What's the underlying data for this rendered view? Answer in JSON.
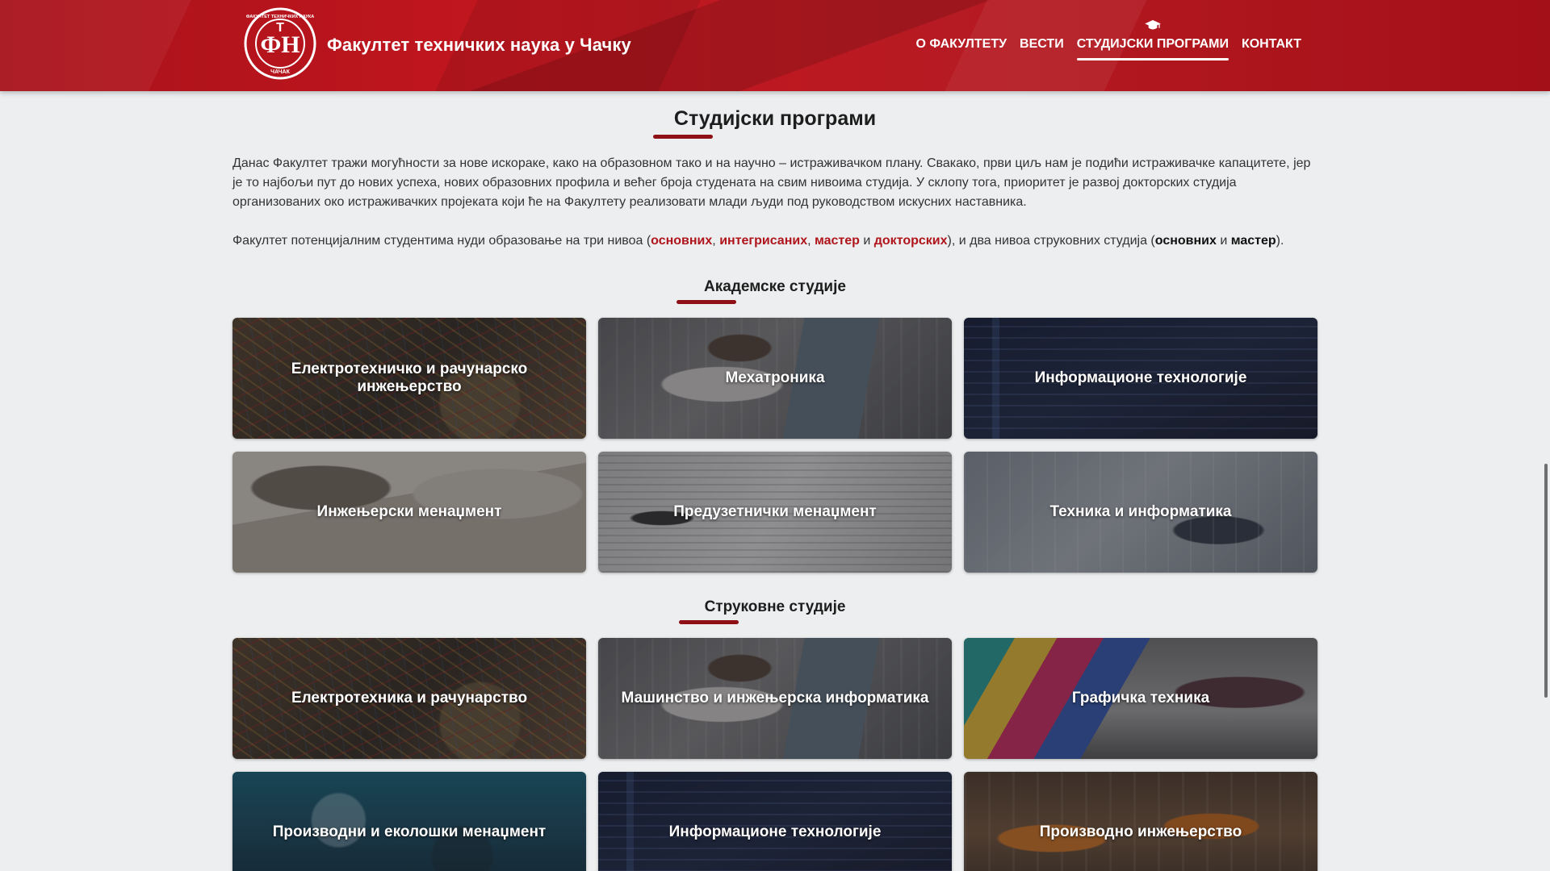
{
  "header": {
    "site_title": "Факултет техничких наука у Чачку",
    "logo_text": "ФТН",
    "logo_ring_top": "ФАКУЛТЕТ ТЕХНИЧКИХ НАУКА",
    "logo_ring_bottom": "ЧАЧАК",
    "nav": [
      {
        "label": "О ФАКУЛТЕТУ",
        "active": false
      },
      {
        "label": "ВЕСТИ",
        "active": false
      },
      {
        "label": "СТУДИЈСКИ ПРОГРАМИ",
        "active": true,
        "icon": "graduation-cap-icon"
      },
      {
        "label": "КОНТАКТ",
        "active": false
      }
    ]
  },
  "page_title": "Студијски програми",
  "intro": {
    "paragraph1": "Данас Факултет тражи могућности за нове искораке, како на образовном тако и на научно – истраживачком плану. Свакако, први циљ нам је подићи истраживачке капацитете, јер је то најбољи пут до нових успеха, нових образовних профила и већег броја студената на свим нивоима студија. У склопу тога, приоритет је развој докторских студија организованих око истраживачких пројеката који ће на Факултету реализовати млади људи под руководством искусних наставника.",
    "p2_prefix": "Факултет потенцијалним студентима нуди образовање на три нивоа (",
    "link_basic": "основних",
    "sep1": ", ",
    "link_integrated": "интегрисаних",
    "sep2": ", ",
    "link_master": "мастер",
    "and1": " и ",
    "link_doctoral": "докторских",
    "p2_middle": "), и два нивоа струковних студија (",
    "bold_basic": "основних",
    "and2": " и ",
    "bold_master": "мастер",
    "p2_suffix": ")."
  },
  "academic": {
    "title": "Академске студије",
    "cards": [
      {
        "label": "Електротехничко и рачунарско инжењерство"
      },
      {
        "label": "Мехатроника"
      },
      {
        "label": "Информационе технологије"
      },
      {
        "label": "Инжењерски менаџмент"
      },
      {
        "label": "Предузетнички менаџмент"
      },
      {
        "label": "Техника и информатика"
      }
    ]
  },
  "vocational": {
    "title": "Струковне студије",
    "cards": [
      {
        "label": "Електротехника и рачунарство"
      },
      {
        "label": "Машинство и инжењерска информатика"
      },
      {
        "label": "Графичка техника"
      },
      {
        "label": "Производни и еколошки менаџмент"
      },
      {
        "label": "Информационе технологије"
      },
      {
        "label": "Производно инжењерство"
      }
    ]
  },
  "colors": {
    "brand_red": "#b71a22",
    "accent_underline": "#8e0f14",
    "link_red": "#b0151c",
    "page_bg": "#eceeef"
  }
}
